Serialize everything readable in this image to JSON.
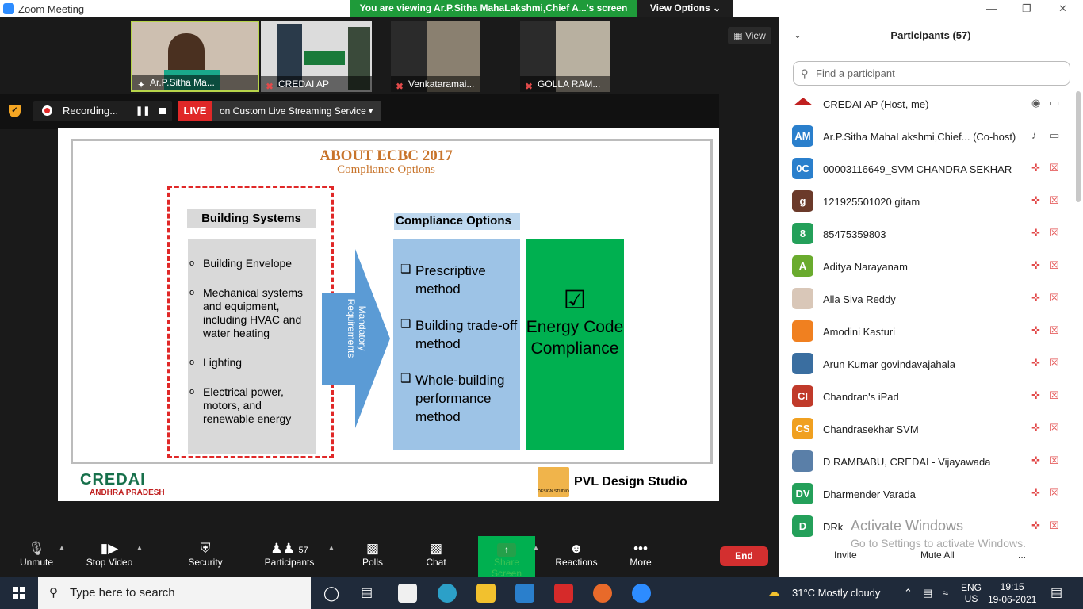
{
  "window": {
    "title": "Zoom Meeting",
    "viewing_banner": "You are viewing Ar.P.Sitha MahaLakshmi,Chief A...'s screen",
    "view_options": "View Options"
  },
  "view_button": "View",
  "thumbnails": [
    {
      "label": "Ar.P.Sitha Ma..."
    },
    {
      "label": "CREDAI AP"
    },
    {
      "label": "Venkataramai..."
    },
    {
      "label": "GOLLA RAM..."
    }
  ],
  "recording": {
    "status": "Recording...",
    "live": "LIVE",
    "stream": "on Custom Live Streaming Service"
  },
  "slide": {
    "title": "ABOUT ECBC 2017",
    "subtitle": "Compliance Options",
    "building_systems_title": "Building Systems",
    "building_systems": [
      "Building Envelope",
      "Mechanical systems and equipment, including HVAC and water heating",
      "Lighting",
      "Electrical power, motors, and renewable energy"
    ],
    "arrow_text": "Mandatory Requirements",
    "compliance_title": "Compliance Options",
    "compliance_options": [
      "Prescriptive method",
      "Building trade-off method",
      "Whole-building performance method"
    ],
    "energy_check": "☑",
    "energy_text": "Energy Code Compliance",
    "logo_left": "CREDAI",
    "logo_left_sub": "ANDHRA PRADESH",
    "logo_right_small": "DESIGN STUDIO",
    "logo_right": "PVL Design Studio"
  },
  "toolbar": {
    "unmute": "Unmute",
    "stop_video": "Stop Video",
    "security": "Security",
    "participants": "Participants",
    "participant_count": "57",
    "polls": "Polls",
    "chat": "Chat",
    "share_screen": "Share Screen",
    "reactions": "Reactions",
    "more": "More",
    "end": "End"
  },
  "panel": {
    "title": "Participants (57)",
    "search_placeholder": "Find a participant",
    "participants": [
      {
        "initials": "",
        "name": "CREDAI AP (Host, me)",
        "color": "#ffffff"
      },
      {
        "initials": "AM",
        "name": "Ar.P.Sitha MahaLakshmi,Chief... (Co-host)",
        "color": "#2a7fcc"
      },
      {
        "initials": "0C",
        "name": "00003116649_SVM CHANDRA SEKHAR",
        "color": "#2a7fcc"
      },
      {
        "initials": "g",
        "name": "121925501020 gitam",
        "color": "#6b3a2a"
      },
      {
        "initials": "8",
        "name": "85475359803",
        "color": "#24a05a"
      },
      {
        "initials": "A",
        "name": "Aditya Narayanam",
        "color": "#6aab2e"
      },
      {
        "initials": "",
        "name": "Alla Siva Reddy",
        "color": "#d9c7b8"
      },
      {
        "initials": "",
        "name": "Amodini Kasturi",
        "color": "#f08020"
      },
      {
        "initials": "",
        "name": "Arun Kumar govindavajahala",
        "color": "#3a6ea0"
      },
      {
        "initials": "CI",
        "name": "Chandran's iPad",
        "color": "#c03a2a"
      },
      {
        "initials": "CS",
        "name": "Chandrasekhar SVM",
        "color": "#f0a020"
      },
      {
        "initials": "",
        "name": "D RAMBABU, CREDAI - Vijayawada",
        "color": "#5a7fa8"
      },
      {
        "initials": "DV",
        "name": "Dharmender Varada",
        "color": "#24a05a"
      },
      {
        "initials": "D",
        "name": "DRk",
        "color": "#24a05a"
      }
    ],
    "invite": "Invite",
    "mute_all": "Mute All",
    "more": "...",
    "watermark_title": "Activate Windows",
    "watermark_sub": "Go to Settings to activate Windows."
  },
  "taskbar": {
    "search_placeholder": "Type here to search",
    "weather": "31°C  Mostly cloudy",
    "lang_top": "ENG",
    "lang_bottom": "US",
    "time": "19:15",
    "date": "19-06-2021"
  }
}
